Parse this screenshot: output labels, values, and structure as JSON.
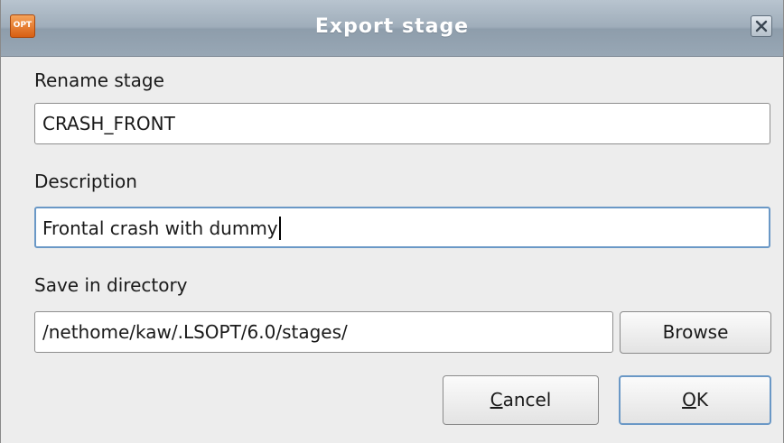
{
  "window": {
    "title": "Export stage",
    "app_icon_text": "OPT",
    "close_icon": "close-icon"
  },
  "form": {
    "rename_label": "Rename stage",
    "rename_value": "CRASH_FRONT",
    "description_label": "Description",
    "description_value": "Frontal crash with dummy",
    "directory_label": "Save in directory",
    "directory_value": "/nethome/kaw/.LSOPT/6.0/stages/",
    "browse_label": "Browse"
  },
  "buttons": {
    "cancel_mnemonic": "C",
    "cancel_rest": "ancel",
    "ok_mnemonic": "O",
    "ok_rest": "K"
  },
  "colors": {
    "titlebar": "#9fadba",
    "focus": "#6a98c6",
    "app_icon": "#e0701e"
  }
}
